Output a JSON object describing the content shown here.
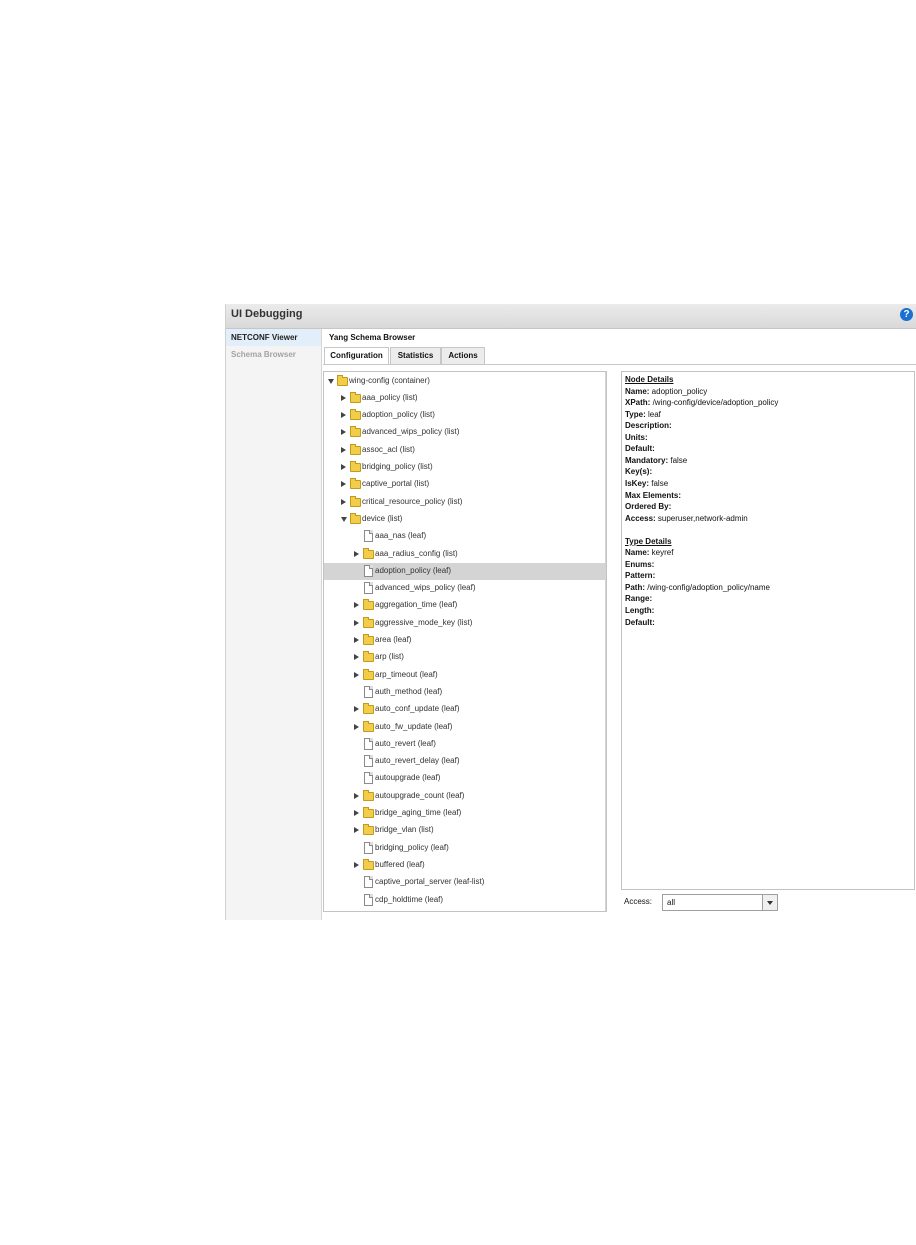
{
  "window": {
    "title": "UI Debugging",
    "help_glyph": "?"
  },
  "sidebar": {
    "items": [
      {
        "label": "NETCONF Viewer",
        "active": true
      },
      {
        "label": "Schema Browser",
        "active": false
      }
    ]
  },
  "main": {
    "title": "Yang Schema Browser",
    "tabs": [
      {
        "label": "Configuration",
        "active": true
      },
      {
        "label": "Statistics",
        "active": false
      },
      {
        "label": "Actions",
        "active": false
      }
    ]
  },
  "tree": {
    "nodes": [
      {
        "label": "wing-config (container)",
        "icon": "folder-icon",
        "expand": "down",
        "depth": 0
      },
      {
        "label": "aaa_policy (list)",
        "icon": "folder-icon",
        "expand": "right",
        "depth": 1
      },
      {
        "label": "adoption_policy (list)",
        "icon": "folder-icon",
        "expand": "right",
        "depth": 1
      },
      {
        "label": "advanced_wips_policy (list)",
        "icon": "folder-icon",
        "expand": "right",
        "depth": 1
      },
      {
        "label": "assoc_acl (list)",
        "icon": "folder-icon",
        "expand": "right",
        "depth": 1
      },
      {
        "label": "bridging_policy (list)",
        "icon": "folder-icon",
        "expand": "right",
        "depth": 1
      },
      {
        "label": "captive_portal (list)",
        "icon": "folder-icon",
        "expand": "right",
        "depth": 1
      },
      {
        "label": "critical_resource_policy (list)",
        "icon": "folder-icon",
        "expand": "right",
        "depth": 1
      },
      {
        "label": "device (list)",
        "icon": "folder-icon",
        "expand": "down",
        "depth": 1
      },
      {
        "label": "aaa_nas (leaf)",
        "icon": "document-icon",
        "expand": "none",
        "depth": 2
      },
      {
        "label": "aaa_radius_config (list)",
        "icon": "folder-icon",
        "expand": "right",
        "depth": 2
      },
      {
        "label": "adoption_policy (leaf)",
        "icon": "document-icon",
        "expand": "none",
        "depth": 2,
        "selected": true
      },
      {
        "label": "advanced_wips_policy (leaf)",
        "icon": "document-icon",
        "expand": "none",
        "depth": 2
      },
      {
        "label": "aggregation_time (leaf)",
        "icon": "folder-icon",
        "expand": "right",
        "depth": 2
      },
      {
        "label": "aggressive_mode_key (list)",
        "icon": "folder-icon",
        "expand": "right",
        "depth": 2
      },
      {
        "label": "area (leaf)",
        "icon": "folder-icon",
        "expand": "right",
        "depth": 2
      },
      {
        "label": "arp (list)",
        "icon": "folder-icon",
        "expand": "right",
        "depth": 2
      },
      {
        "label": "arp_timeout (leaf)",
        "icon": "folder-icon",
        "expand": "right",
        "depth": 2
      },
      {
        "label": "auth_method (leaf)",
        "icon": "document-icon",
        "expand": "none",
        "depth": 2
      },
      {
        "label": "auto_conf_update (leaf)",
        "icon": "folder-icon",
        "expand": "right",
        "depth": 2
      },
      {
        "label": "auto_fw_update (leaf)",
        "icon": "folder-icon",
        "expand": "right",
        "depth": 2
      },
      {
        "label": "auto_revert (leaf)",
        "icon": "document-icon",
        "expand": "none",
        "depth": 2
      },
      {
        "label": "auto_revert_delay (leaf)",
        "icon": "document-icon",
        "expand": "none",
        "depth": 2
      },
      {
        "label": "autoupgrade (leaf)",
        "icon": "document-icon",
        "expand": "none",
        "depth": 2
      },
      {
        "label": "autoupgrade_count (leaf)",
        "icon": "folder-icon",
        "expand": "right",
        "depth": 2
      },
      {
        "label": "bridge_aging_time (leaf)",
        "icon": "folder-icon",
        "expand": "right",
        "depth": 2
      },
      {
        "label": "bridge_vlan (list)",
        "icon": "folder-icon",
        "expand": "right",
        "depth": 2
      },
      {
        "label": "bridging_policy (leaf)",
        "icon": "document-icon",
        "expand": "none",
        "depth": 2
      },
      {
        "label": "buffered (leaf)",
        "icon": "folder-icon",
        "expand": "right",
        "depth": 2
      },
      {
        "label": "captive_portal_server (leaf-list)",
        "icon": "document-icon",
        "expand": "none",
        "depth": 2
      },
      {
        "label": "cdp_holdtime (leaf)",
        "icon": "document-icon",
        "expand": "none",
        "depth": 2
      }
    ]
  },
  "details": {
    "node_heading": "Node Details",
    "node_fields": [
      {
        "key": "Name:",
        "value": " adoption_policy"
      },
      {
        "key": "XPath:",
        "value": " /wing-config/device/adoption_policy"
      },
      {
        "key": "Type:",
        "value": " leaf"
      },
      {
        "key": "Description:",
        "value": ""
      },
      {
        "key": "Units:",
        "value": ""
      },
      {
        "key": "Default:",
        "value": ""
      },
      {
        "key": "Mandatory:",
        "value": " false"
      },
      {
        "key": "Key(s):",
        "value": ""
      },
      {
        "key": "IsKey:",
        "value": " false"
      },
      {
        "key": "Max Elements:",
        "value": ""
      },
      {
        "key": "Ordered By:",
        "value": ""
      },
      {
        "key": "Access:",
        "value": " superuser,network-admin"
      }
    ],
    "type_heading": "Type Details",
    "type_fields": [
      {
        "key": "Name:",
        "value": " keyref"
      },
      {
        "key": "Enums:",
        "value": ""
      },
      {
        "key": "Pattern:",
        "value": ""
      },
      {
        "key": "Path:",
        "value": " /wing-config/adoption_policy/name"
      },
      {
        "key": "Range:",
        "value": ""
      },
      {
        "key": "Length:",
        "value": ""
      },
      {
        "key": "Default:",
        "value": ""
      }
    ]
  },
  "access_filter": {
    "label": "Access:",
    "value": "all"
  }
}
